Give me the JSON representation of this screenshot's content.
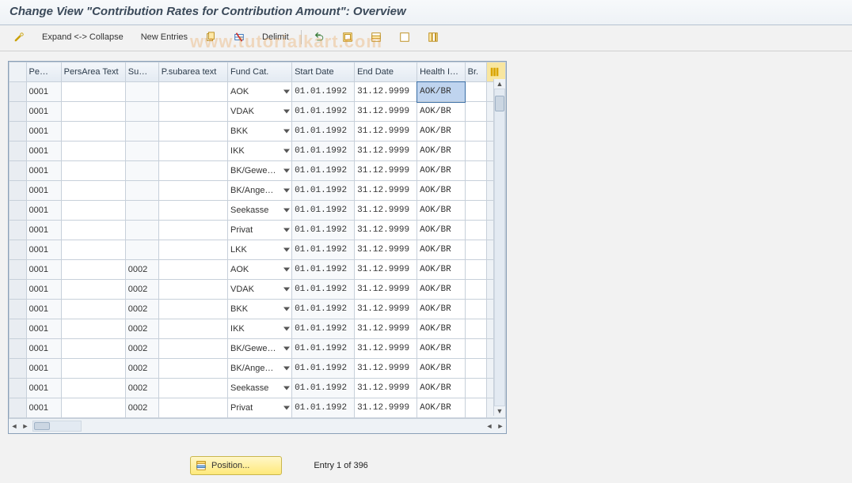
{
  "header": {
    "title": "Change View \"Contribution Rates for Contribution Amount\": Overview"
  },
  "toolbar": {
    "expand_collapse": "Expand <-> Collapse",
    "new_entries": "New Entries",
    "delimit": "Delimit"
  },
  "table": {
    "columns": {
      "pe": "Pe…",
      "persarea_text": "PersArea Text",
      "su": "Su…",
      "psubarea_text": "P.subarea text",
      "fund_cat": "Fund Cat.",
      "start_date": "Start Date",
      "end_date": "End Date",
      "health_i": "Health I…",
      "br": "Br."
    },
    "rows": [
      {
        "pe": "0001",
        "persarea_text": "",
        "su": "",
        "psubarea_text": "",
        "fund_cat": "AOK",
        "start_date": "01.01.1992",
        "end_date": "31.12.9999",
        "health_i": "AOK/BR",
        "br": ""
      },
      {
        "pe": "0001",
        "persarea_text": "",
        "su": "",
        "psubarea_text": "",
        "fund_cat": "VDAK",
        "start_date": "01.01.1992",
        "end_date": "31.12.9999",
        "health_i": "AOK/BR",
        "br": ""
      },
      {
        "pe": "0001",
        "persarea_text": "",
        "su": "",
        "psubarea_text": "",
        "fund_cat": "BKK",
        "start_date": "01.01.1992",
        "end_date": "31.12.9999",
        "health_i": "AOK/BR",
        "br": ""
      },
      {
        "pe": "0001",
        "persarea_text": "",
        "su": "",
        "psubarea_text": "",
        "fund_cat": "IKK",
        "start_date": "01.01.1992",
        "end_date": "31.12.9999",
        "health_i": "AOK/BR",
        "br": ""
      },
      {
        "pe": "0001",
        "persarea_text": "",
        "su": "",
        "psubarea_text": "",
        "fund_cat": "BK/Gewe…",
        "start_date": "01.01.1992",
        "end_date": "31.12.9999",
        "health_i": "AOK/BR",
        "br": ""
      },
      {
        "pe": "0001",
        "persarea_text": "",
        "su": "",
        "psubarea_text": "",
        "fund_cat": "BK/Ange…",
        "start_date": "01.01.1992",
        "end_date": "31.12.9999",
        "health_i": "AOK/BR",
        "br": ""
      },
      {
        "pe": "0001",
        "persarea_text": "",
        "su": "",
        "psubarea_text": "",
        "fund_cat": "Seekasse",
        "start_date": "01.01.1992",
        "end_date": "31.12.9999",
        "health_i": "AOK/BR",
        "br": ""
      },
      {
        "pe": "0001",
        "persarea_text": "",
        "su": "",
        "psubarea_text": "",
        "fund_cat": "Privat",
        "start_date": "01.01.1992",
        "end_date": "31.12.9999",
        "health_i": "AOK/BR",
        "br": ""
      },
      {
        "pe": "0001",
        "persarea_text": "",
        "su": "",
        "psubarea_text": "",
        "fund_cat": "LKK",
        "start_date": "01.01.1992",
        "end_date": "31.12.9999",
        "health_i": "AOK/BR",
        "br": ""
      },
      {
        "pe": "0001",
        "persarea_text": "",
        "su": "0002",
        "psubarea_text": "",
        "fund_cat": "AOK",
        "start_date": "01.01.1992",
        "end_date": "31.12.9999",
        "health_i": "AOK/BR",
        "br": ""
      },
      {
        "pe": "0001",
        "persarea_text": "",
        "su": "0002",
        "psubarea_text": "",
        "fund_cat": "VDAK",
        "start_date": "01.01.1992",
        "end_date": "31.12.9999",
        "health_i": "AOK/BR",
        "br": ""
      },
      {
        "pe": "0001",
        "persarea_text": "",
        "su": "0002",
        "psubarea_text": "",
        "fund_cat": "BKK",
        "start_date": "01.01.1992",
        "end_date": "31.12.9999",
        "health_i": "AOK/BR",
        "br": ""
      },
      {
        "pe": "0001",
        "persarea_text": "",
        "su": "0002",
        "psubarea_text": "",
        "fund_cat": "IKK",
        "start_date": "01.01.1992",
        "end_date": "31.12.9999",
        "health_i": "AOK/BR",
        "br": ""
      },
      {
        "pe": "0001",
        "persarea_text": "",
        "su": "0002",
        "psubarea_text": "",
        "fund_cat": "BK/Gewe…",
        "start_date": "01.01.1992",
        "end_date": "31.12.9999",
        "health_i": "AOK/BR",
        "br": ""
      },
      {
        "pe": "0001",
        "persarea_text": "",
        "su": "0002",
        "psubarea_text": "",
        "fund_cat": "BK/Ange…",
        "start_date": "01.01.1992",
        "end_date": "31.12.9999",
        "health_i": "AOK/BR",
        "br": ""
      },
      {
        "pe": "0001",
        "persarea_text": "",
        "su": "0002",
        "psubarea_text": "",
        "fund_cat": "Seekasse",
        "start_date": "01.01.1992",
        "end_date": "31.12.9999",
        "health_i": "AOK/BR",
        "br": ""
      },
      {
        "pe": "0001",
        "persarea_text": "",
        "su": "0002",
        "psubarea_text": "",
        "fund_cat": "Privat",
        "start_date": "01.01.1992",
        "end_date": "31.12.9999",
        "health_i": "AOK/BR",
        "br": ""
      }
    ],
    "selected_cell": {
      "row": 0,
      "col": "health_i"
    }
  },
  "footer": {
    "position_label": "Position...",
    "entry_text": "Entry 1 of 396"
  },
  "watermark": "www.tutorialkart.com"
}
